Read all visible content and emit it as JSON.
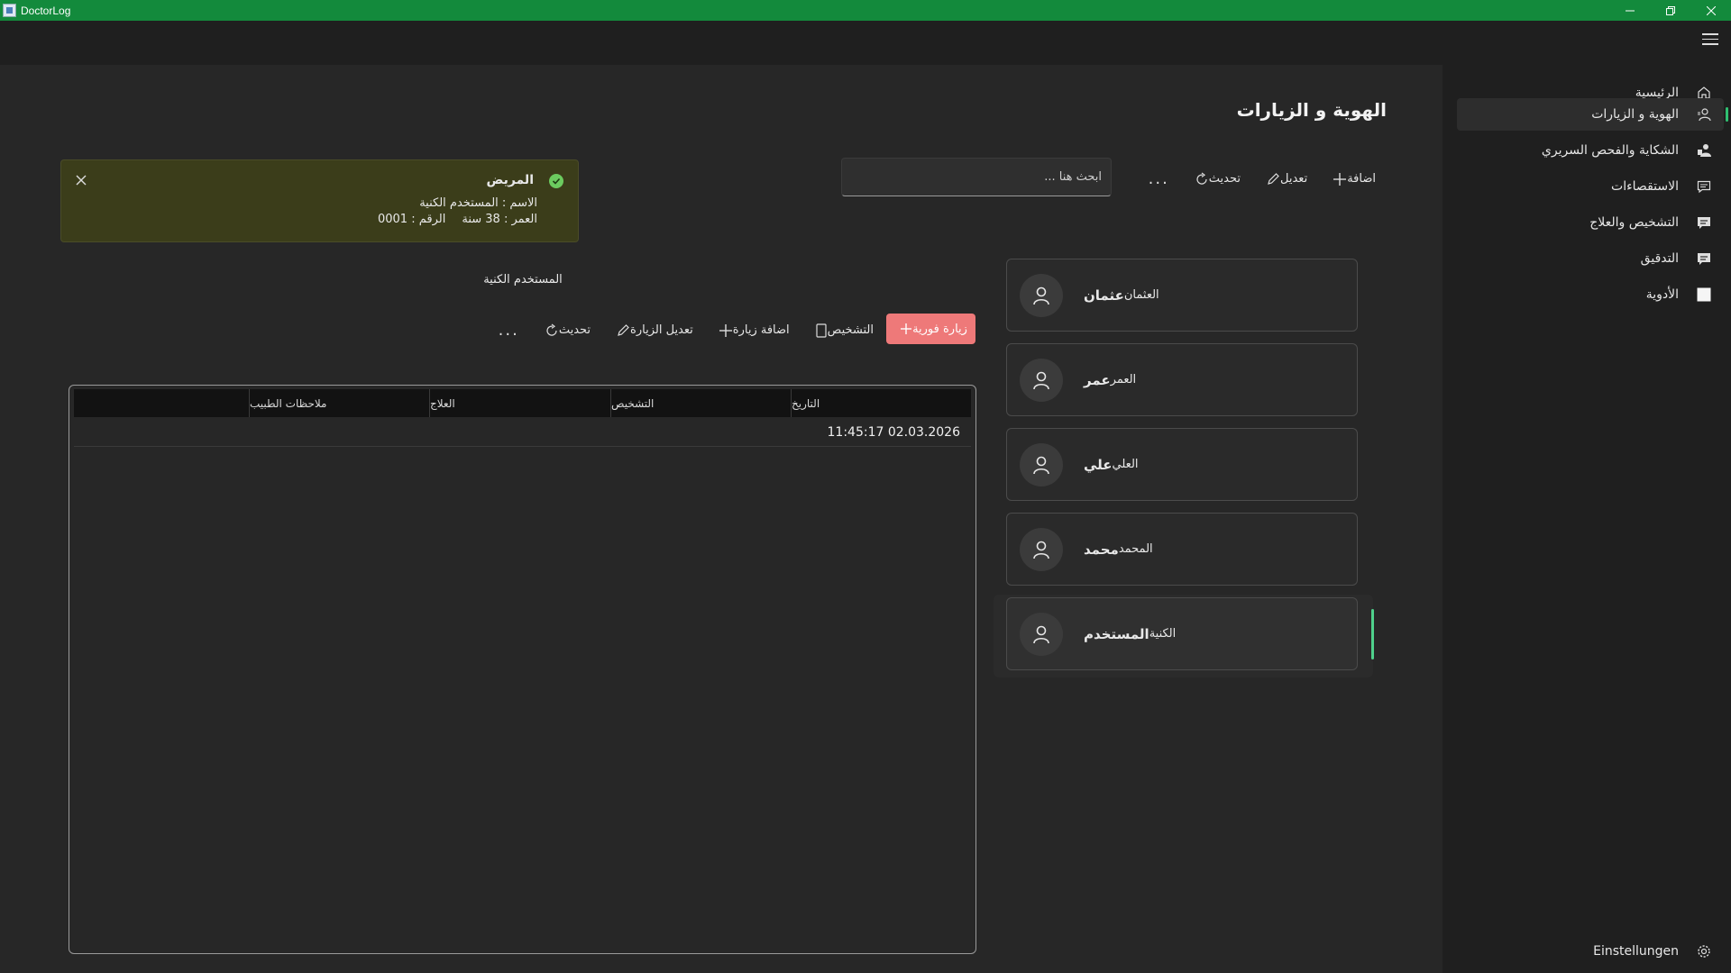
{
  "window": {
    "title": "DoctorLog"
  },
  "sidebar": {
    "items": [
      {
        "label": "الرئيسية",
        "icon": "home-icon",
        "active": false
      },
      {
        "label": "الهوية و الزيارات",
        "icon": "person-id-icon",
        "active": true
      },
      {
        "label": "الشكاية والفحص السريري",
        "icon": "person-exam-icon",
        "active": false
      },
      {
        "label": "الاستقصاءات",
        "icon": "chat-icon",
        "active": false
      },
      {
        "label": "التشخيص والعلاج",
        "icon": "message-icon",
        "active": false
      },
      {
        "label": "التدقيق",
        "icon": "message-icon",
        "active": false
      },
      {
        "label": "الأدوية",
        "icon": "square-icon",
        "active": false
      }
    ],
    "settings_label": "Einstellungen"
  },
  "main": {
    "title": "الهوية و الزيارات",
    "toolbar": {
      "add": "اضافة",
      "edit": "تعديل",
      "refresh": "تحديث",
      "more": "..."
    },
    "search": {
      "placeholder": "ابحث هنا ..."
    },
    "infobar": {
      "title": "المريض",
      "name_line": "الاسم : المستخدم  الكنية",
      "age": "العمر : 38 سنة",
      "number": "الرقم : 0001"
    },
    "patients": [
      {
        "first": "عثمان",
        "last": "العثمان"
      },
      {
        "first": "عمر",
        "last": "العمر"
      },
      {
        "first": "علي",
        "last": "العلي"
      },
      {
        "first": "محمد",
        "last": "المحمد"
      },
      {
        "first": "المستخدم",
        "last": "الكنية"
      }
    ],
    "selected_patient": "المستخدم الكنية",
    "visit_toolbar": {
      "instant_visit": "زيارة فورية",
      "diagnosis": "التشخيص",
      "add_visit": "اضافة زيارة",
      "edit_visit": "تعديل الزيارة",
      "refresh": "تحديث",
      "more": "..."
    },
    "table": {
      "columns": [
        "التاريخ",
        "التشخيص",
        "العلاج",
        "ملاحظات الطبيب",
        ""
      ],
      "rows": [
        [
          "11:45:17 02.03.2026",
          "",
          "",
          "",
          ""
        ]
      ]
    }
  },
  "colors": {
    "titlebar": "#138a3c",
    "accent": "#4fd18c",
    "visit_button": "#ee7979",
    "infobar": "#3b3d1a"
  }
}
